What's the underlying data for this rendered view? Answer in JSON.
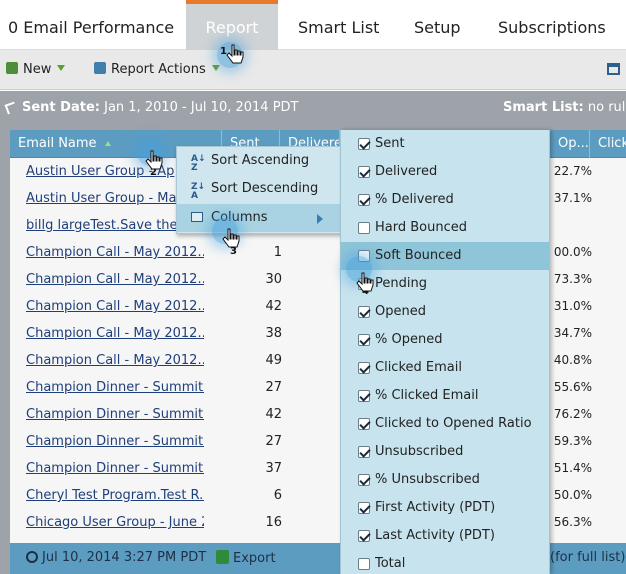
{
  "tabs": [
    {
      "label": "0 Email Performance",
      "active": false
    },
    {
      "label": "Report",
      "active": true
    },
    {
      "label": "Smart List",
      "active": false
    },
    {
      "label": "Setup",
      "active": false
    },
    {
      "label": "Subscriptions",
      "active": false
    }
  ],
  "toolbar": {
    "new_label": "New",
    "report_actions_label": "Report Actions"
  },
  "filter": {
    "sent_date_label": "Sent Date:",
    "sent_date_value": "Jan 1, 2010 - Jul 10, 2014 PDT",
    "smart_list_label": "Smart List:",
    "smart_list_value": "no rules"
  },
  "grid": {
    "headers": {
      "email_name": "Email Name",
      "sent": "Sent",
      "delivered": "Delivere",
      "opened": "Op...",
      "click": "Click"
    },
    "rows": [
      {
        "name": "Austin User Group - Ap",
        "sent": "",
        "pct": "22.7%"
      },
      {
        "name": "Austin User Group - March",
        "sent": "",
        "pct": "37.1%"
      },
      {
        "name": "billg largeTest.Save the date",
        "sent": "",
        "pct": ""
      },
      {
        "name": "Champion Call - May 2012...",
        "sent": "1",
        "pct": "00.0%"
      },
      {
        "name": "Champion Call - May 2012...",
        "sent": "30",
        "pct": "73.3%"
      },
      {
        "name": "Champion Call - May 2012...",
        "sent": "42",
        "pct": "31.0%"
      },
      {
        "name": "Champion Call - May 2012...",
        "sent": "38",
        "pct": "34.7%"
      },
      {
        "name": "Champion Call - May 2012...",
        "sent": "49",
        "pct": "40.8%"
      },
      {
        "name": "Champion Dinner - Summit...",
        "sent": "27",
        "pct": "55.6%"
      },
      {
        "name": "Champion Dinner - Summit...",
        "sent": "42",
        "pct": "76.2%"
      },
      {
        "name": "Champion Dinner - Summit...",
        "sent": "27",
        "pct": "59.3%"
      },
      {
        "name": "Champion Dinner - Summit...",
        "sent": "37",
        "pct": "51.4%"
      },
      {
        "name": "Cheryl Test Program.Test R...",
        "sent": "6",
        "pct": "50.0%"
      },
      {
        "name": "Chicago User Group - June 2...",
        "sent": "16",
        "pct": "56.3%"
      }
    ]
  },
  "footer": {
    "timestamp": "Jul 10, 2014 3:27 PM PDT",
    "export_label": "Export",
    "full_list_text": "(for full list)"
  },
  "context_menu": {
    "sort_ascending": "Sort Ascending",
    "sort_descending": "Sort Descending",
    "columns": "Columns"
  },
  "columns_menu": [
    {
      "label": "Sent",
      "checked": true
    },
    {
      "label": "Delivered",
      "checked": true
    },
    {
      "label": "% Delivered",
      "checked": true
    },
    {
      "label": "Hard Bounced",
      "checked": false
    },
    {
      "label": "Soft Bounced",
      "checked": false,
      "highlighted": true
    },
    {
      "label": "Pending",
      "checked": true
    },
    {
      "label": "Opened",
      "checked": true
    },
    {
      "label": "% Opened",
      "checked": true
    },
    {
      "label": "Clicked Email",
      "checked": true
    },
    {
      "label": "% Clicked Email",
      "checked": true
    },
    {
      "label": "Clicked to Opened Ratio",
      "checked": true
    },
    {
      "label": "Unsubscribed",
      "checked": true
    },
    {
      "label": "% Unsubscribed",
      "checked": true
    },
    {
      "label": "First Activity (PDT)",
      "checked": true
    },
    {
      "label": "Last Activity (PDT)",
      "checked": true
    },
    {
      "label": "Total",
      "checked": false
    }
  ],
  "steps": [
    "1",
    "2",
    "3",
    "4"
  ],
  "colors": {
    "accent_tab": "#e8792b",
    "header_blue": "#5d9cc1",
    "menu_bg": "#c7e4ee",
    "link": "#1f3f7a"
  }
}
